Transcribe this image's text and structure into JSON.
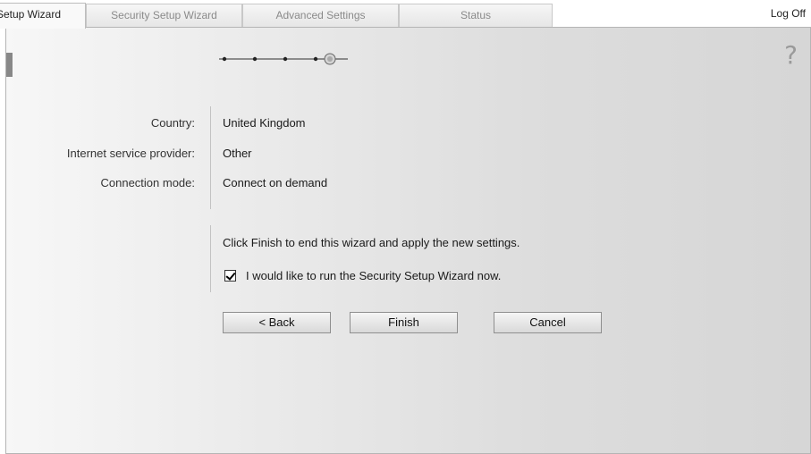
{
  "tabs": [
    {
      "label": "Setup Wizard",
      "active": true
    },
    {
      "label": "Security Setup Wizard",
      "active": false
    },
    {
      "label": "Advanced Settings",
      "active": false
    },
    {
      "label": "Status",
      "active": false
    }
  ],
  "header": {
    "logoff_label": "Log Off"
  },
  "progress": {
    "total_steps": 5,
    "current_step": 5
  },
  "help": {
    "icon": "?"
  },
  "summary": {
    "rows": [
      {
        "label": "Country:",
        "value": "United Kingdom"
      },
      {
        "label": "Internet service provider:",
        "value": "Other"
      },
      {
        "label": "Connection mode:",
        "value": "Connect on demand"
      }
    ]
  },
  "finish": {
    "instruction": "Click Finish to end this wizard and apply the new settings.",
    "checkbox_label": "I would like to run the Security Setup Wizard now.",
    "checkbox_checked": true
  },
  "buttons": {
    "back": "< Back",
    "finish": "Finish",
    "cancel": "Cancel"
  }
}
